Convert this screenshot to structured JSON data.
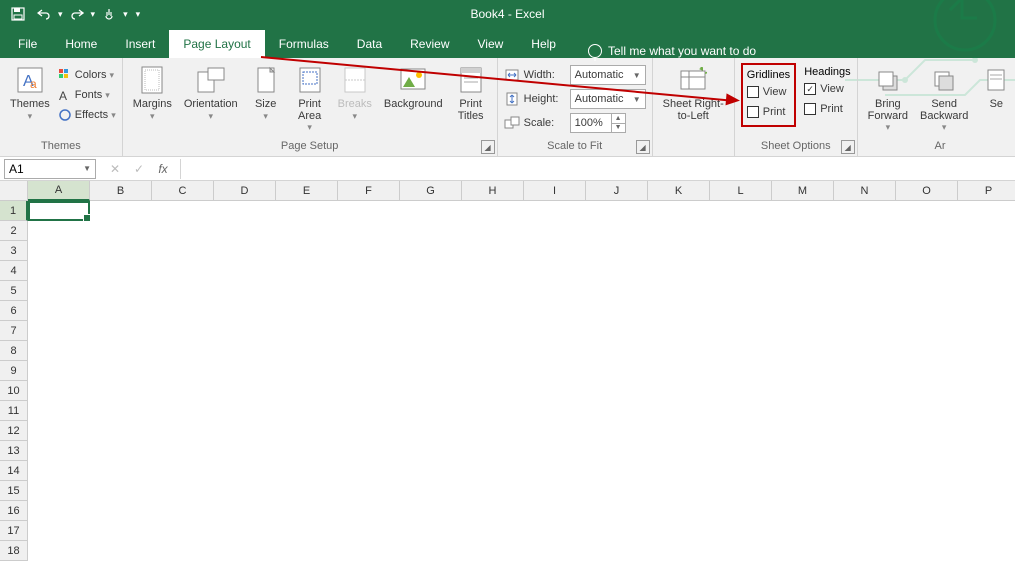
{
  "title": "Book4 - Excel",
  "tabs": [
    "File",
    "Home",
    "Insert",
    "Page Layout",
    "Formulas",
    "Data",
    "Review",
    "View",
    "Help"
  ],
  "active_tab": "Page Layout",
  "tellme": "Tell me what you want to do",
  "namebox": "A1",
  "themes": {
    "main": "Themes",
    "colors": "Colors",
    "fonts": "Fonts",
    "effects": "Effects",
    "group": "Themes"
  },
  "page_setup": {
    "margins": "Margins",
    "orientation": "Orientation",
    "size": "Size",
    "print_area": "Print\nArea",
    "breaks": "Breaks",
    "background": "Background",
    "print_titles": "Print\nTitles",
    "group": "Page Setup"
  },
  "scale": {
    "width": "Width:",
    "height": "Height:",
    "scale": "Scale:",
    "auto": "Automatic",
    "pct": "100%",
    "group": "Scale to Fit"
  },
  "sheet_rtl": "Sheet Right-\nto-Left",
  "sheet_options": {
    "gridlines": "Gridlines",
    "headings": "Headings",
    "view": "View",
    "print": "Print",
    "group": "Sheet Options"
  },
  "arrange": {
    "bring": "Bring\nForward",
    "send": "Send\nBackward",
    "sel": "Se",
    "group": "Ar"
  },
  "columns": [
    "A",
    "B",
    "C",
    "D",
    "E",
    "F",
    "G",
    "H",
    "I",
    "J",
    "K",
    "L",
    "M",
    "N",
    "O",
    "P"
  ],
  "rows": [
    "1",
    "2",
    "3",
    "4",
    "5",
    "6",
    "7",
    "8",
    "9",
    "10",
    "11",
    "12",
    "13",
    "14",
    "15",
    "16",
    "17",
    "18"
  ]
}
